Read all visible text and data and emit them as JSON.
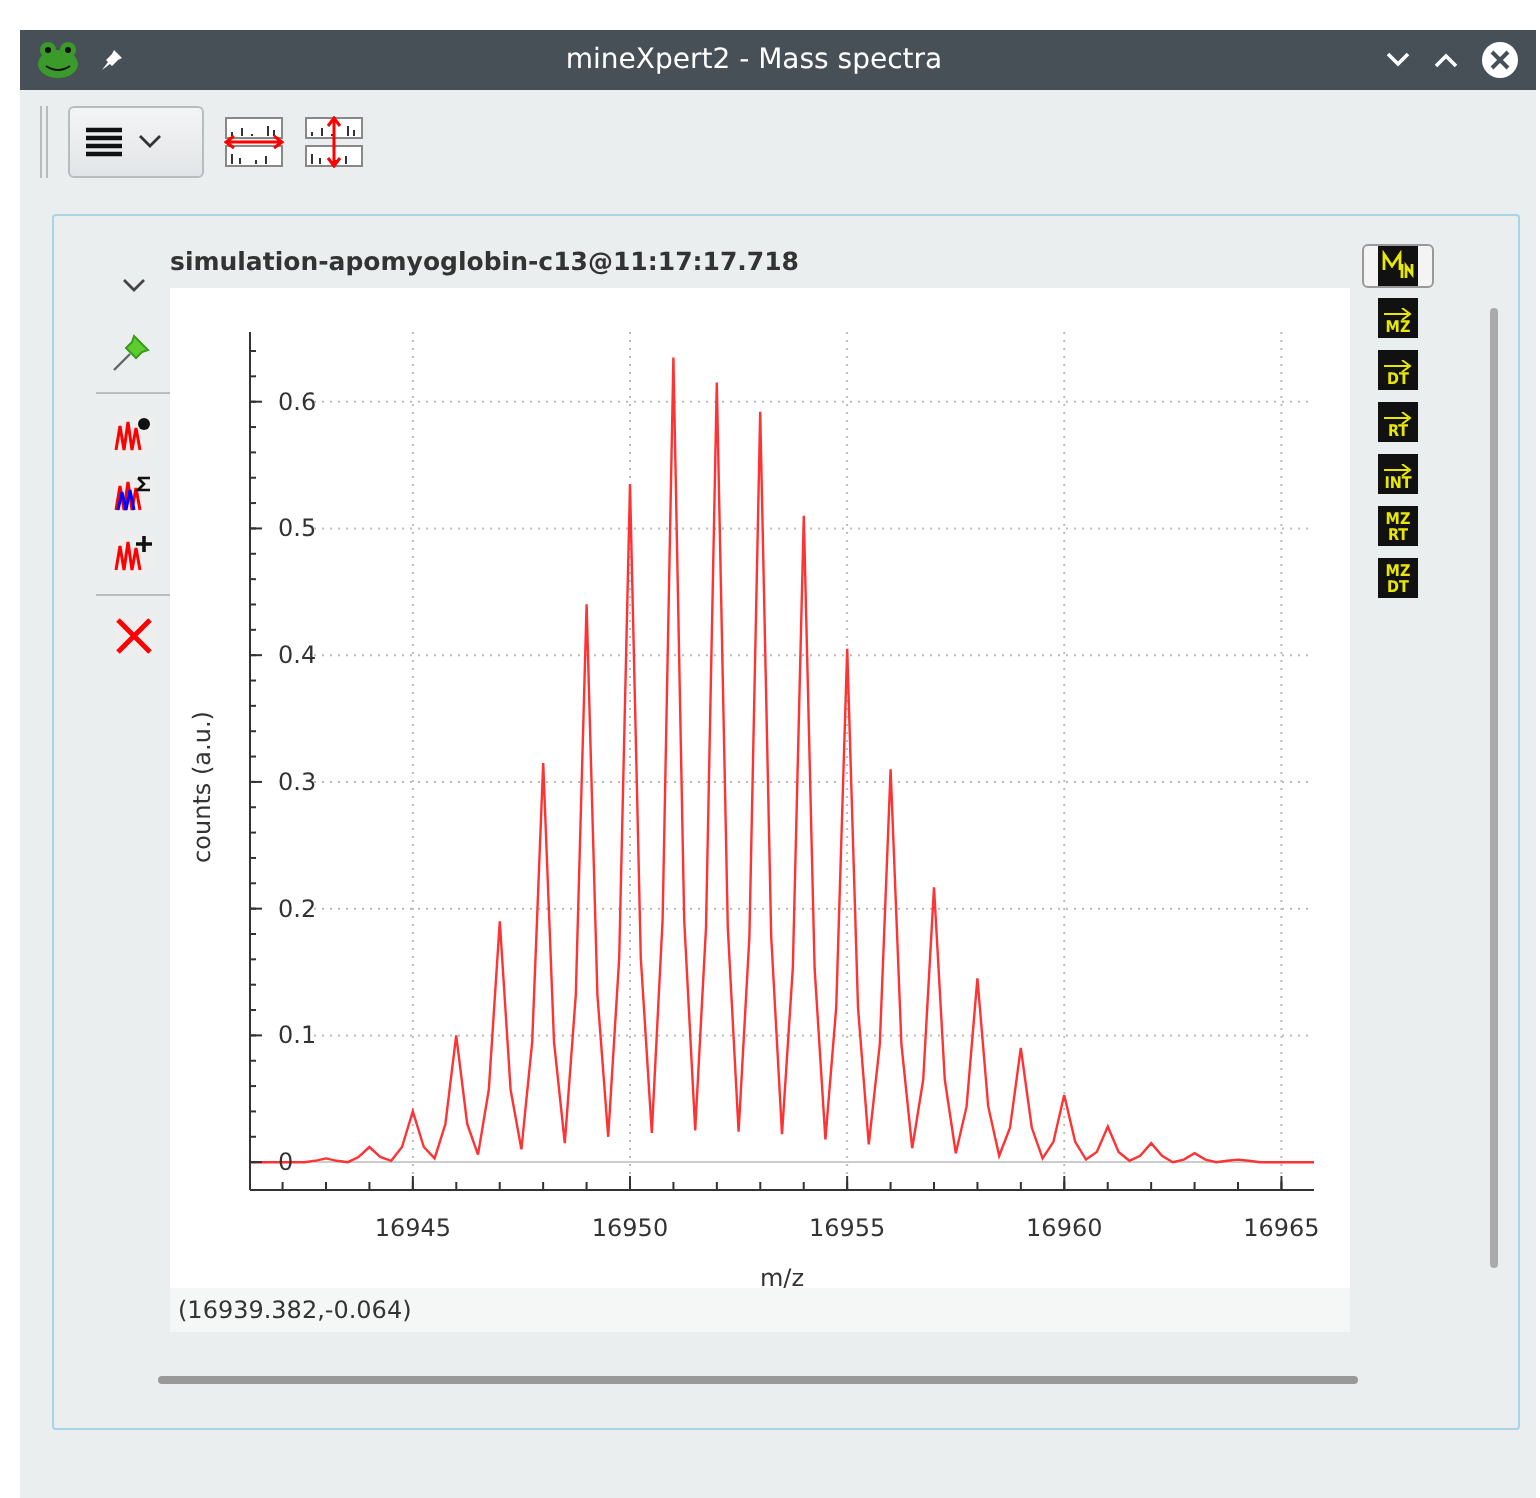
{
  "window": {
    "title": "mineXpert2 - Mass spectra"
  },
  "plot": {
    "title": "simulation-apomyoglobin-c13@11:17:17.718",
    "coordinates": "(16939.382,-0.064)",
    "chart_data": {
      "type": "line",
      "grid": true,
      "xlabel": "m/z",
      "ylabel": "counts (a.u.)",
      "xlim": [
        16941.25,
        16965.75
      ],
      "ylim": [
        -0.022,
        0.655
      ],
      "xticks": [
        16945,
        16950,
        16955,
        16960,
        16965
      ],
      "yticks": [
        0,
        0.1,
        0.2,
        0.3,
        0.4,
        0.5,
        0.6
      ],
      "x": [
        16941.25,
        16941.5,
        16941.75,
        16942,
        16942.25,
        16942.5,
        16942.75,
        16943,
        16943.25,
        16943.5,
        16943.75,
        16944,
        16944.25,
        16944.5,
        16944.75,
        16945,
        16945.25,
        16945.5,
        16945.75,
        16946,
        16946.25,
        16946.5,
        16946.75,
        16947,
        16947.25,
        16947.5,
        16947.75,
        16948,
        16948.25,
        16948.5,
        16948.75,
        16949,
        16949.25,
        16949.5,
        16949.75,
        16950,
        16950.25,
        16950.5,
        16950.75,
        16951,
        16951.25,
        16951.5,
        16951.75,
        16952,
        16952.25,
        16952.5,
        16952.75,
        16953,
        16953.25,
        16953.5,
        16953.75,
        16954,
        16954.25,
        16954.5,
        16954.75,
        16955,
        16955.25,
        16955.5,
        16955.75,
        16956,
        16956.25,
        16956.5,
        16956.75,
        16957,
        16957.25,
        16957.5,
        16957.75,
        16958,
        16958.25,
        16958.5,
        16958.75,
        16959,
        16959.25,
        16959.5,
        16959.75,
        16960,
        16960.25,
        16960.5,
        16960.75,
        16961,
        16961.25,
        16961.5,
        16961.75,
        16962,
        16962.25,
        16962.5,
        16962.75,
        16963,
        16963.25,
        16963.5,
        16963.75,
        16964,
        16964.25,
        16964.5,
        16964.75,
        16965,
        16965.25,
        16965.5,
        16965.75
      ],
      "series": [
        {
          "color": "#ff3333",
          "values": [
            0,
            0,
            0,
            0,
            0,
            0,
            0.001,
            0.003,
            0.001,
            0,
            0.004,
            0.012,
            0.004,
            0.001,
            0.012,
            0.04,
            0.012,
            0.003,
            0.03,
            0.1,
            0.03,
            0.006,
            0.057,
            0.19,
            0.057,
            0.01,
            0.095,
            0.315,
            0.095,
            0.015,
            0.132,
            0.44,
            0.132,
            0.02,
            0.161,
            0.535,
            0.161,
            0.023,
            0.191,
            0.635,
            0.191,
            0.025,
            0.185,
            0.615,
            0.185,
            0.024,
            0.178,
            0.592,
            0.178,
            0.022,
            0.153,
            0.51,
            0.153,
            0.018,
            0.122,
            0.405,
            0.122,
            0.014,
            0.093,
            0.31,
            0.093,
            0.011,
            0.065,
            0.217,
            0.065,
            0.007,
            0.044,
            0.145,
            0.044,
            0.005,
            0.027,
            0.09,
            0.027,
            0.003,
            0.016,
            0.053,
            0.016,
            0.002,
            0.008,
            0.028,
            0.008,
            0.001,
            0.005,
            0.015,
            0.005,
            0,
            0.002,
            0.007,
            0.002,
            0,
            0.001,
            0.002,
            0.001,
            0,
            0,
            0,
            0,
            0,
            0
          ]
        }
      ]
    }
  },
  "right_toolbar": [
    {
      "kind": "integrate",
      "selected": true
    },
    {
      "kind": "arrow",
      "top": "MZ",
      "selected": false
    },
    {
      "kind": "arrow",
      "top": "DT",
      "selected": false
    },
    {
      "kind": "arrow",
      "top": "RT",
      "selected": false
    },
    {
      "kind": "arrow",
      "top": "INT",
      "selected": false
    },
    {
      "kind": "map",
      "top": "MZ",
      "bottom": "RT",
      "selected": false
    },
    {
      "kind": "map",
      "top": "MZ",
      "bottom": "DT",
      "selected": false
    }
  ]
}
